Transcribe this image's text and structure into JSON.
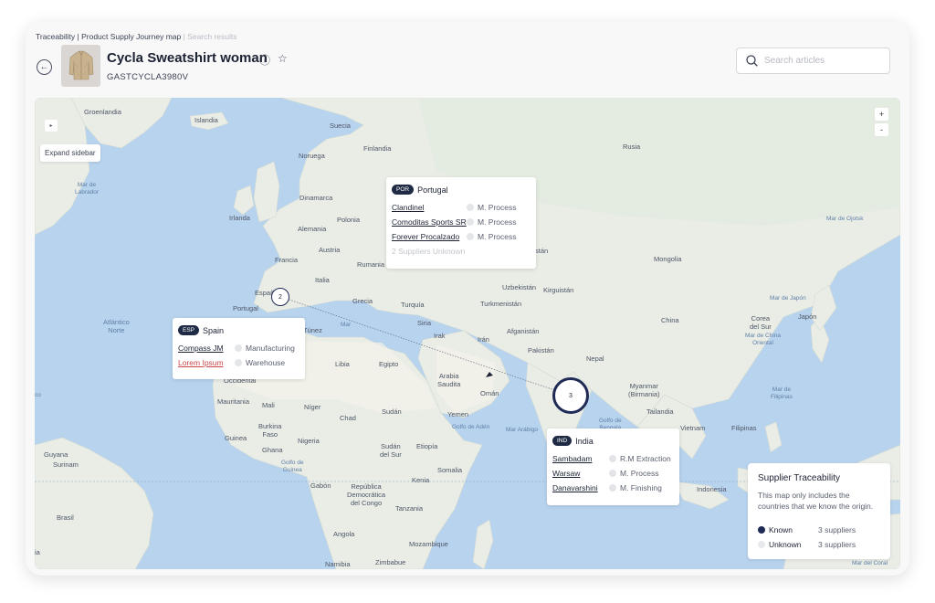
{
  "breadcrumb": {
    "part1": "Traceability",
    "sep1": " | ",
    "part2": "Product Supply Journey map",
    "sep2": " | ",
    "part3": "Search results"
  },
  "product": {
    "title": "Cycla Sweatshirt woman",
    "code": "GASTCYCLA3980V"
  },
  "search": {
    "placeholder": "Search articles"
  },
  "map": {
    "expand_label": "Expand sidebar",
    "zoom_in": "+",
    "zoom_out": "-",
    "places": {
      "groenlandia": "Groenlandia",
      "islandia": "Islandia",
      "suecia": "Suecia",
      "finlandia": "Finlandia",
      "noruega": "Noruega",
      "dinamarca": "Dinamarca",
      "irlanda": "Irlanda",
      "alemania": "Alemania",
      "polonia": "Polonia",
      "francia": "Francia",
      "austria": "Austria",
      "rumania": "Rumania",
      "italia": "Italia",
      "espana": "España",
      "portugal": "Portugal",
      "grecia": "Grecia",
      "turquia": "Turquía",
      "siria": "Siria",
      "irak": "Irak",
      "iran": "Irán",
      "tunez": "Túnez",
      "libia": "Libia",
      "egipto": "Egipto",
      "arabia": "Arabia\nSaudita",
      "oman": "Omán",
      "yemen": "Yemen",
      "sudan": "Sudán",
      "sudan_sur": "Sudán\ndel Sur",
      "etiopia": "Etiopía",
      "somalia": "Somalia",
      "kenia": "Kenia",
      "tanzania": "Tanzania",
      "rdc": "República\nDemocrática\ndel Congo",
      "gabon": "Gabón",
      "angola": "Angola",
      "namibia": "Namibia",
      "zimbabue": "Zimbabue",
      "mozambique": "Mozambique",
      "mali": "Mali",
      "niger": "Níger",
      "chad": "Chad",
      "nigeria": "Nigeria",
      "mauritania": "Mauritania",
      "burkina": "Burkina\nFaso",
      "guinea": "Guinea",
      "ghana": "Ghana",
      "occidental": "Occidental",
      "guyana": "Guyana",
      "surinam": "Surinam",
      "brasil": "Brasil",
      "rusia": "Rusia",
      "uzbekistan": "Uzbekistán",
      "kirguistan": "Kirguistán",
      "turkmenistan": "Turkmenistán",
      "afganistan": "Afganistán",
      "pakistan": "Pakistán",
      "stan": "stán",
      "nepal": "Nepal",
      "china": "China",
      "mongolia": "Mongolia",
      "corea": "Corea\ndel Sur",
      "japon": "Japón",
      "myanmar": "Myanmar\n(Birmania)",
      "tailandia": "Tailandia",
      "vietnam": "Vietnam",
      "filipinas": "Filipinas",
      "indonesia": "Indonesia",
      "ia": "ia"
    },
    "seas": {
      "labrador": "Mar de\nLabrador",
      "atlantico": "Atlántico\nNorte",
      "okhotsk": "Mar de Ojotsk",
      "japon": "Mar de Japón",
      "china_or": "Mar de China\nOriental",
      "filipinas": "Mar de\nFilipinas",
      "arabigo": "Mar Arábigo",
      "aden": "Golfo de Adén",
      "bengala": "Golfo de\nBengala",
      "guinea": "Golfo de\nGuinea",
      "coral": "Mar del Coral",
      "co": "co",
      "mar": "Mar"
    },
    "clusters": {
      "spain_count": "2",
      "india_count": "3"
    }
  },
  "popups": {
    "portugal": {
      "code": "POR",
      "country": "Portugal",
      "rows": [
        {
          "supplier": "Clandinel",
          "process": "M. Process"
        },
        {
          "supplier": "Comoditas Sports SR",
          "process": "M. Process"
        },
        {
          "supplier": "Forever Procalzado",
          "process": "M. Process"
        }
      ],
      "unknown": "2 Suppliers Unknown"
    },
    "spain": {
      "code": "ESP",
      "country": "Spain",
      "rows": [
        {
          "supplier": "Compass JM",
          "process": "Manufacturing"
        },
        {
          "supplier": "Lorem Ipsum",
          "process": "Warehouse"
        }
      ]
    },
    "india": {
      "code": "IND",
      "country": "India",
      "rows": [
        {
          "supplier": "Sambadam",
          "process": "R.M Extraction"
        },
        {
          "supplier": "Warsaw",
          "process": "M. Process"
        },
        {
          "supplier": "Danavarshini",
          "process": "M. Finishing"
        }
      ]
    }
  },
  "legend": {
    "title": "Supplier Traceability",
    "description": "This map only includes the countries that we know the origin.",
    "items": [
      {
        "label": "Known",
        "count": "3 suppliers",
        "color": "#1f2a55"
      },
      {
        "label": "Unknown",
        "count": "3 suppliers",
        "color": "#e8e9ed"
      }
    ]
  },
  "colors": {
    "water": "#b8d3ee",
    "land": "#e9ede6",
    "accent": "#1f2a55",
    "link_red": "#c9484a"
  }
}
